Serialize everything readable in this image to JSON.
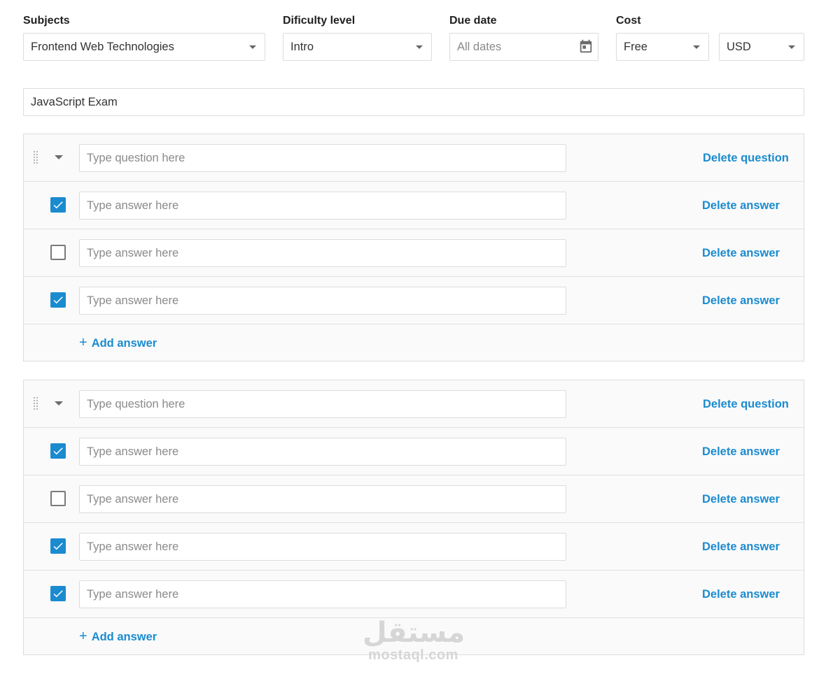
{
  "filters": {
    "subjects": {
      "label": "Subjects",
      "value": "Frontend Web Technologies"
    },
    "difficulty": {
      "label": "Dificulty level",
      "value": "Intro"
    },
    "due_date": {
      "label": "Due date",
      "placeholder": "All dates"
    },
    "cost": {
      "label": "Cost",
      "value": "Free",
      "currency": "USD"
    }
  },
  "exam": {
    "title": "JavaScript Exam"
  },
  "questions": [
    {
      "placeholder": "Type question here",
      "delete_label": "Delete question",
      "add_answer_label": "Add answer",
      "answers": [
        {
          "checked": true,
          "placeholder": "Type answer here",
          "delete_label": "Delete answer"
        },
        {
          "checked": false,
          "placeholder": "Type answer here",
          "delete_label": "Delete answer"
        },
        {
          "checked": true,
          "placeholder": "Type answer here",
          "delete_label": "Delete answer"
        }
      ]
    },
    {
      "placeholder": "Type question here",
      "delete_label": "Delete question",
      "add_answer_label": "Add answer",
      "answers": [
        {
          "checked": true,
          "placeholder": "Type answer here",
          "delete_label": "Delete answer"
        },
        {
          "checked": false,
          "placeholder": "Type answer here",
          "delete_label": "Delete answer"
        },
        {
          "checked": true,
          "placeholder": "Type answer here",
          "delete_label": "Delete answer"
        },
        {
          "checked": true,
          "placeholder": "Type answer here",
          "delete_label": "Delete answer"
        }
      ]
    }
  ],
  "watermark": {
    "arabic": "مستقل",
    "latin": "mostaql.com"
  },
  "colors": {
    "accent": "#1b8bd0",
    "border": "#dcdcdc",
    "panel": "#fafafa"
  },
  "icons": {
    "drag": "drag-handle-icon",
    "collapse": "caret-down-icon",
    "calendar": "calendar-icon",
    "add": "plus-icon",
    "check": "checkmark-icon"
  }
}
